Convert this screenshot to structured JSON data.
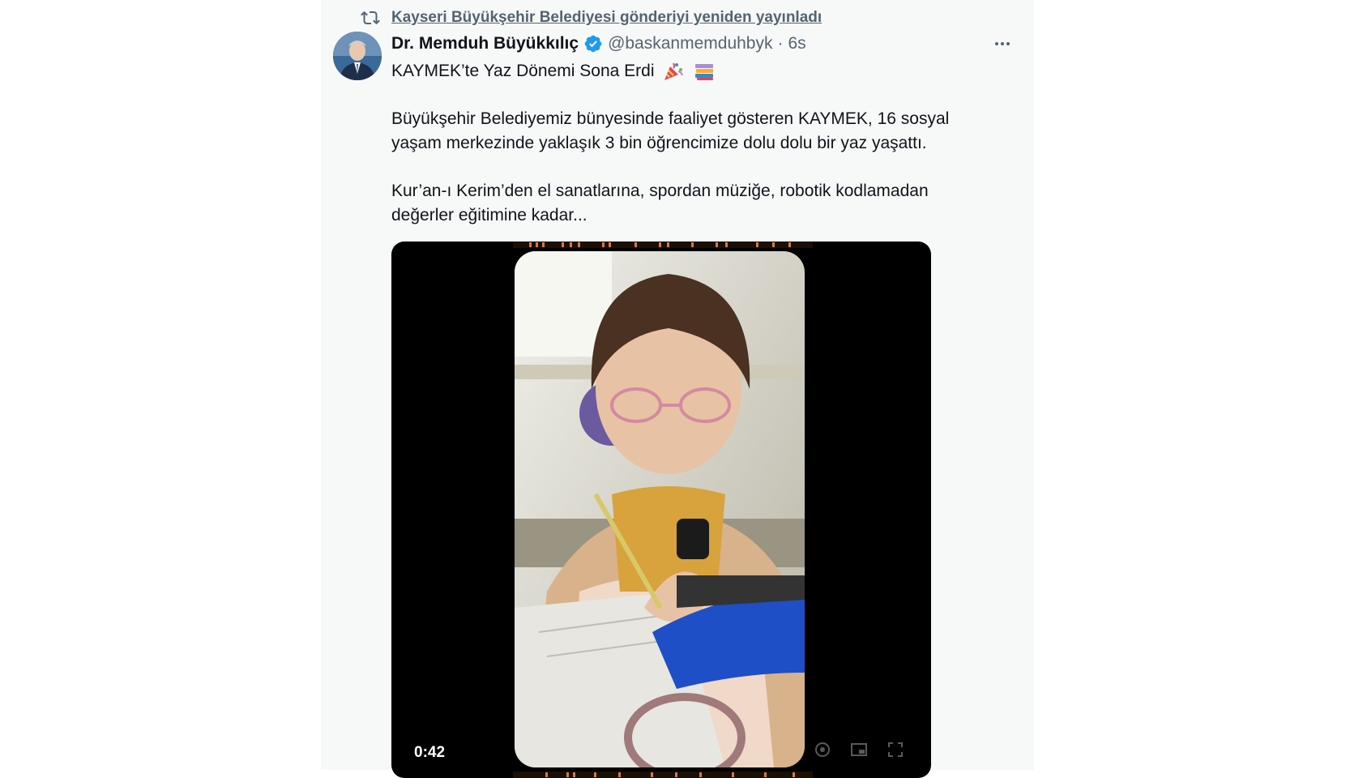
{
  "retweet": {
    "text": "Kayseri Büyükşehir Belediyesi gönderiyi yeniden yayınladı",
    "icon": "retweet-icon"
  },
  "author": {
    "display_name": "Dr. Memduh Büyükkılıç",
    "handle": "@baskanmemduhbyk",
    "separator": "·",
    "time": "6s",
    "verified": true
  },
  "tweet": {
    "line1": "KAYMEK’te Yaz Dönemi Sona Erdi",
    "para2_line1": "Büyükşehir Belediyemiz bünyesinde faaliyet gösteren KAYMEK, 16 sosyal",
    "para2_line2": "yaşam merkezinde yaklaşık 3 bin öğrencimize dolu dolu bir yaz yaşattı.",
    "para3_line1": "Kur’an-ı Kerim’den el sanatlarına, spordan müziğe, robotik kodlamadan",
    "para3_line2": "değerler eğitimine kadar..."
  },
  "media": {
    "duration": "0:42"
  },
  "colors": {
    "panel_bg": "#f7f9f9",
    "verified": "#1d9bf0",
    "secondary_text": "#536471"
  }
}
